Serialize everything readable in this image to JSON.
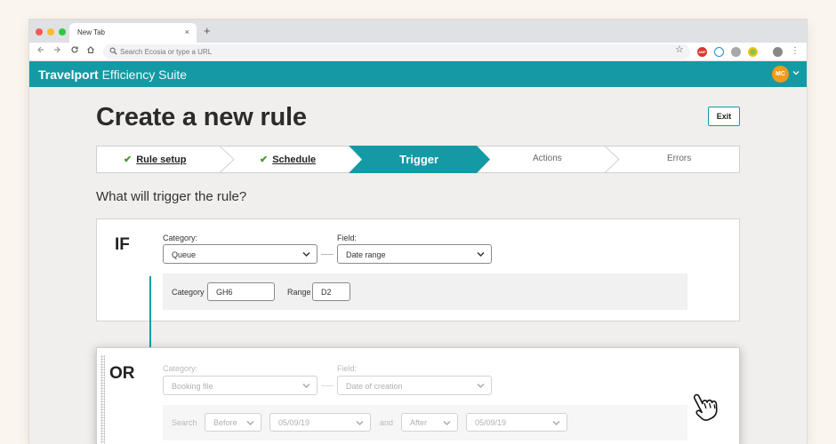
{
  "browser": {
    "tab_title": "New Tab",
    "tab_close": "×",
    "new_tab": "+",
    "address_placeholder": "Search Ecosia or type a URL",
    "menu": "⋮"
  },
  "app": {
    "brand_bold": "Travelport",
    "brand_light": " Efficiency Suite",
    "user_initials": "MC",
    "accent": "#139aa4"
  },
  "page": {
    "title": "Create a new rule",
    "exit_label": "Exit",
    "question": "What will trigger the rule?"
  },
  "steps": [
    {
      "label": "Rule setup",
      "state": "done",
      "check": "✔"
    },
    {
      "label": "Schedule",
      "state": "done",
      "check": "✔"
    },
    {
      "label": "Trigger",
      "state": "active"
    },
    {
      "label": "Actions",
      "state": "pending"
    },
    {
      "label": "Errors",
      "state": "pending"
    }
  ],
  "if_block": {
    "operator": "IF",
    "category_label": "Category:",
    "category_value": "Queue",
    "field_label": "Field:",
    "field_value": "Date range",
    "params": [
      {
        "label": "Category",
        "value": "GH6"
      },
      {
        "label": "Range",
        "value": "D2"
      }
    ]
  },
  "or_block": {
    "operator": "OR",
    "category_label": "Category:",
    "category_value": "Booking file",
    "field_label": "Field:",
    "field_value": "Date of creation",
    "search_label": "Search",
    "before_value": "Before",
    "date1_value": "05/09/19",
    "and_label": "and",
    "after_value": "After",
    "date2_value": "05/09/19"
  }
}
